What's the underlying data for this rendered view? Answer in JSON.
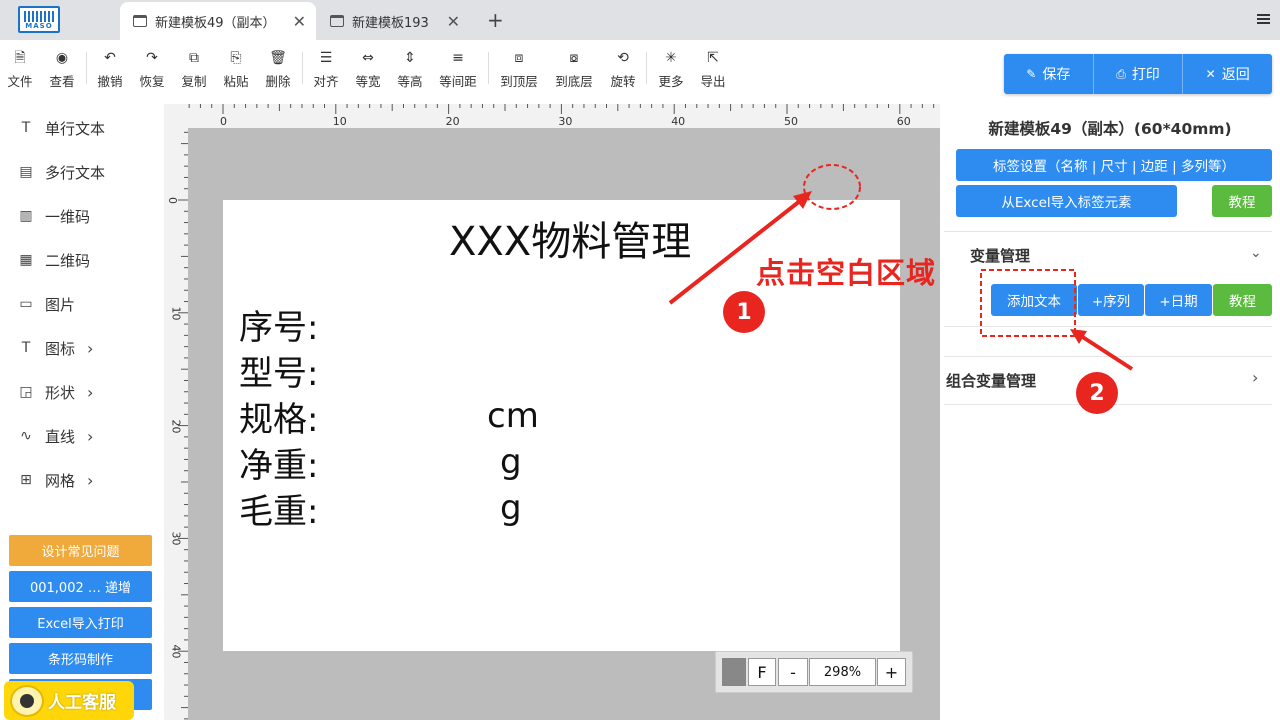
{
  "tabs": [
    {
      "label": "新建模板49（副本）"
    },
    {
      "label": "新建模板193"
    }
  ],
  "logo": {
    "text": "MASO"
  },
  "toolbar": {
    "items": [
      {
        "label": "文件",
        "icon": "file-icon"
      },
      {
        "label": "查看",
        "icon": "eye-icon"
      },
      {
        "label": "撤销",
        "icon": "undo-icon"
      },
      {
        "label": "恢复",
        "icon": "redo-icon"
      },
      {
        "label": "复制",
        "icon": "copy-icon"
      },
      {
        "label": "粘贴",
        "icon": "paste-icon"
      },
      {
        "label": "删除",
        "icon": "trash-icon"
      },
      {
        "label": "对齐",
        "icon": "align-icon"
      },
      {
        "label": "等宽",
        "icon": "equal-width-icon"
      },
      {
        "label": "等高",
        "icon": "equal-height-icon"
      },
      {
        "label": "等间距",
        "icon": "equal-spacing-icon"
      },
      {
        "label": "到顶层",
        "icon": "bring-front-icon"
      },
      {
        "label": "到底层",
        "icon": "send-back-icon"
      },
      {
        "label": "旋转",
        "icon": "rotate-icon"
      },
      {
        "label": "更多",
        "icon": "more-icon"
      },
      {
        "label": "导出",
        "icon": "export-icon"
      }
    ],
    "save": "保存",
    "print": "打印",
    "back": "返回"
  },
  "sidebar": {
    "items": [
      {
        "label": "单行文本",
        "icon": "text-icon"
      },
      {
        "label": "多行文本",
        "icon": "multiline-text-icon"
      },
      {
        "label": "一维码",
        "icon": "barcode-icon"
      },
      {
        "label": "二维码",
        "icon": "qrcode-icon"
      },
      {
        "label": "图片",
        "icon": "image-icon"
      },
      {
        "label": "图标",
        "icon": "text-icon"
      },
      {
        "label": "形状",
        "icon": "shape-icon"
      },
      {
        "label": "直线",
        "icon": "line-icon"
      },
      {
        "label": "网格",
        "icon": "grid-icon"
      }
    ],
    "buttons": [
      {
        "label": "设计常见问题",
        "color": "#f0a93b"
      },
      {
        "label": "001,002 … 递增",
        "color": "#2e8cf0"
      },
      {
        "label": "Excel导入打印",
        "color": "#2e8cf0"
      },
      {
        "label": "条形码制作",
        "color": "#2e8cf0"
      }
    ],
    "support": "人工客服"
  },
  "ruler": {
    "h": [
      "0",
      "10",
      "20",
      "30",
      "40",
      "50",
      "60"
    ],
    "v": [
      "0",
      "10",
      "20",
      "30",
      "40"
    ]
  },
  "label_content": {
    "title": "XXX物料管理",
    "rows": [
      {
        "field": "序号:",
        "value": ""
      },
      {
        "field": "型号:",
        "value": ""
      },
      {
        "field": "规格:",
        "value": "cm"
      },
      {
        "field": "净重:",
        "value": "g"
      },
      {
        "field": "毛重:",
        "value": "g"
      }
    ]
  },
  "zoom": {
    "fit": "F",
    "minus": "-",
    "value": "298%",
    "plus": "+"
  },
  "right": {
    "template_title": "新建模板49（副本）(60*40mm)",
    "settings_btn": "标签设置（名称 | 尺寸 | 边距 | 多列等）",
    "excel_btn": "从Excel导入标签元素",
    "tutorial": "教程",
    "var_section": "变量管理",
    "add_text": "添加文本",
    "add_seq": "+序列",
    "add_date": "+日期",
    "group_section": "组合变量管理"
  },
  "annotation": {
    "text": "点击空白区域",
    "step1": "1",
    "step2": "2",
    "color": "#e8251f"
  },
  "colors": {
    "primary": "#2e8cf0",
    "green": "#5bbb3e",
    "orange": "#f0a93b"
  }
}
